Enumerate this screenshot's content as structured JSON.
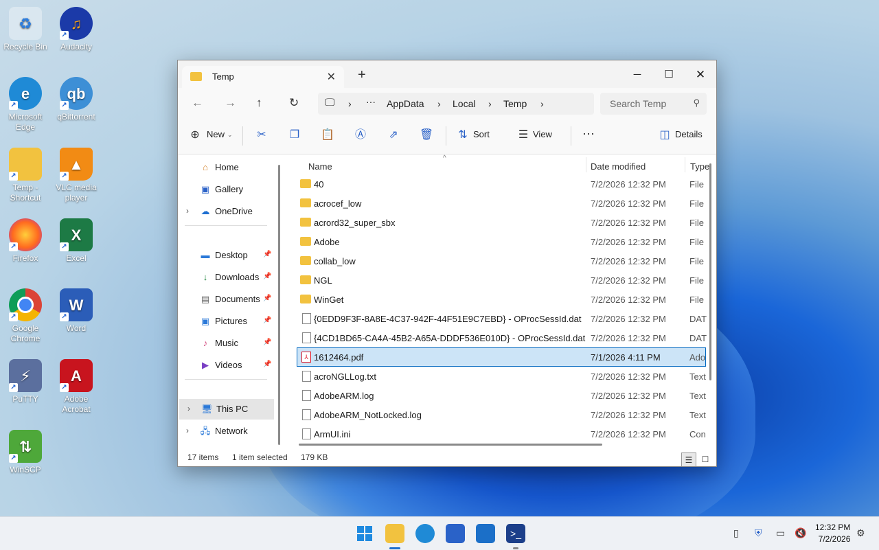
{
  "desktop": {
    "icons": [
      {
        "label": "Recycle Bin",
        "icon": "recycle-bin-icon"
      },
      {
        "label": "Audacity",
        "icon": "audacity-icon"
      },
      {
        "label": "Microsoft Edge",
        "icon": "edge-icon"
      },
      {
        "label": "qBittorrent",
        "icon": "qbittorrent-icon"
      },
      {
        "label": "Temp - Shortcut",
        "icon": "folder-shortcut-icon"
      },
      {
        "label": "VLC media player",
        "icon": "vlc-icon"
      },
      {
        "label": "Firefox",
        "icon": "firefox-icon"
      },
      {
        "label": "Excel",
        "icon": "excel-icon"
      },
      {
        "label": "Google Chrome",
        "icon": "chrome-icon"
      },
      {
        "label": "Word",
        "icon": "word-icon"
      },
      {
        "label": "PuTTY",
        "icon": "putty-icon"
      },
      {
        "label": "Adobe Acrobat",
        "icon": "acrobat-icon"
      },
      {
        "label": "WinSCP",
        "icon": "winscp-icon"
      }
    ]
  },
  "window": {
    "tab_title": "Temp",
    "search_placeholder": "Search Temp",
    "breadcrumb": [
      "AppData",
      "Local",
      "Temp"
    ],
    "toolbar": {
      "new_label": "New",
      "sort_label": "Sort",
      "view_label": "View",
      "details_label": "Details"
    },
    "nav": {
      "home": "Home",
      "gallery": "Gallery",
      "onedrive": "OneDrive",
      "desktop": "Desktop",
      "downloads": "Downloads",
      "documents": "Documents",
      "pictures": "Pictures",
      "music": "Music",
      "videos": "Videos",
      "thispc": "This PC",
      "network": "Network"
    },
    "columns": {
      "name": "Name",
      "date": "Date modified",
      "type": "Type"
    },
    "files": [
      {
        "name": "40",
        "date": "7/2/2026 12:32 PM",
        "type": "File",
        "kind": "folder"
      },
      {
        "name": "acrocef_low",
        "date": "7/2/2026 12:32 PM",
        "type": "File",
        "kind": "folder"
      },
      {
        "name": "acrord32_super_sbx",
        "date": "7/2/2026 12:32 PM",
        "type": "File",
        "kind": "folder"
      },
      {
        "name": "Adobe",
        "date": "7/2/2026 12:32 PM",
        "type": "File",
        "kind": "folder"
      },
      {
        "name": "collab_low",
        "date": "7/2/2026 12:32 PM",
        "type": "File",
        "kind": "folder"
      },
      {
        "name": "NGL",
        "date": "7/2/2026 12:32 PM",
        "type": "File",
        "kind": "folder"
      },
      {
        "name": "WinGet",
        "date": "7/2/2026 12:32 PM",
        "type": "File",
        "kind": "folder"
      },
      {
        "name": "{0EDD9F3F-8A8E-4C37-942F-44F51E9C7EBD} - OProcSessId.dat",
        "date": "7/2/2026 12:32 PM",
        "type": "DAT",
        "kind": "doc"
      },
      {
        "name": "{4CD1BD65-CA4A-45B2-A65A-DDDF536E010D} - OProcSessId.dat",
        "date": "7/2/2026 12:32 PM",
        "type": "DAT",
        "kind": "doc"
      },
      {
        "name": "1612464.pdf",
        "date": "7/1/2026 4:11 PM",
        "type": "Ado",
        "kind": "pdf",
        "selected": true
      },
      {
        "name": "acroNGLLog.txt",
        "date": "7/2/2026 12:32 PM",
        "type": "Text",
        "kind": "doc"
      },
      {
        "name": "AdobeARM.log",
        "date": "7/2/2026 12:32 PM",
        "type": "Text",
        "kind": "doc"
      },
      {
        "name": "AdobeARM_NotLocked.log",
        "date": "7/2/2026 12:32 PM",
        "type": "Text",
        "kind": "doc"
      },
      {
        "name": "ArmUI.ini",
        "date": "7/2/2026 12:32 PM",
        "type": "Con",
        "kind": "doc"
      }
    ],
    "status": {
      "items": "17 items",
      "selected": "1 item selected",
      "size": "179 KB"
    }
  },
  "taskbar": {
    "clock_time": "12:32 PM",
    "clock_date": "7/2/2026",
    "apps": [
      "start-icon",
      "file-explorer-icon",
      "edge-icon",
      "store-icon",
      "outlook-icon",
      "powershell-icon"
    ]
  }
}
